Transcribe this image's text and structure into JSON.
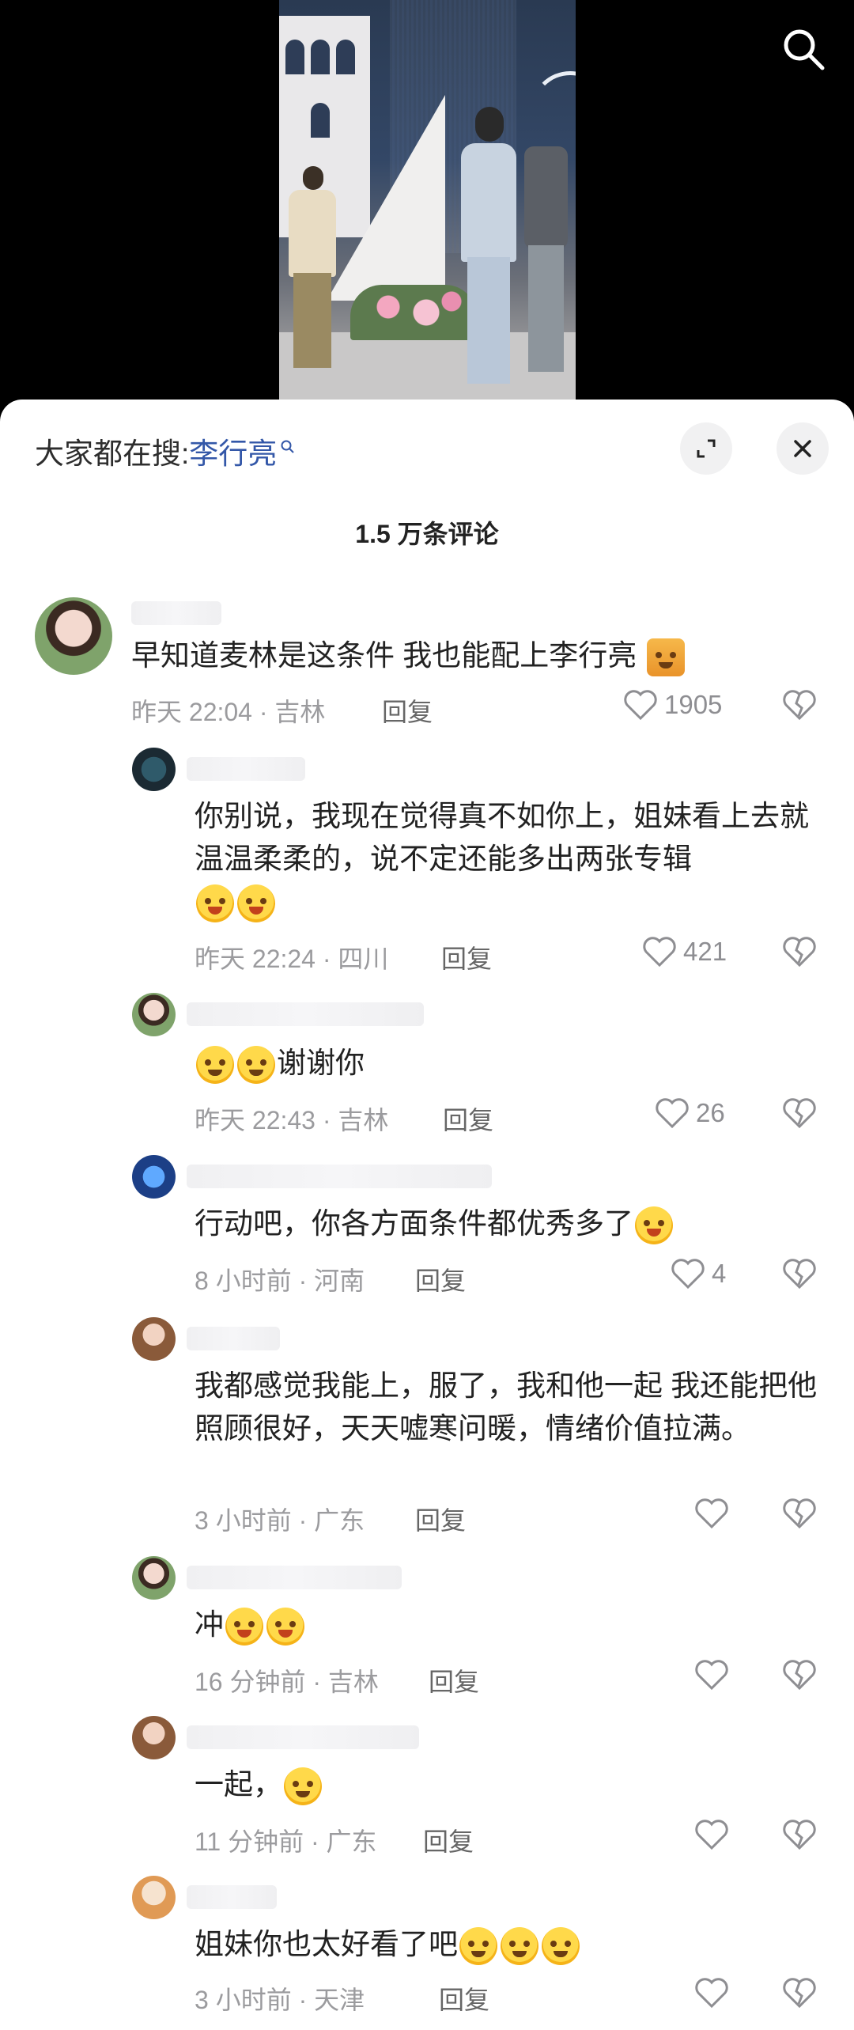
{
  "top": {
    "search_icon": "search-icon"
  },
  "sheet": {
    "search_prefix": "大家都在搜:",
    "search_term": "李行亮",
    "comment_count": "1.5 万条评论"
  },
  "comments": [
    {
      "text": "早知道麦林是这条件 我也能配上李行亮",
      "time": "昨天 22:04 · 吉林",
      "reply": "回复",
      "likes": "1905"
    },
    {
      "text": "你别说，我现在觉得真不如你上，姐妹看上去就温温柔柔的，说不定还能多出两张专辑",
      "time": "昨天 22:24 · 四川",
      "reply": "回复",
      "likes": "421"
    },
    {
      "text": "谢谢你",
      "time": "昨天 22:43 · 吉林",
      "reply": "回复",
      "likes": "26"
    },
    {
      "text": "行动吧，你各方面条件都优秀多了",
      "time": "8 小时前 · 河南",
      "reply": "回复",
      "likes": "4"
    },
    {
      "text": "我都感觉我能上，服了，我和他一起 我还能把他照顾很好，天天嘘寒问暖，情绪价值拉满。",
      "time": "3 小时前 · 广东",
      "reply": "回复",
      "likes": ""
    },
    {
      "text": "冲",
      "time": "16 分钟前 · 吉林",
      "reply": "回复",
      "likes": ""
    },
    {
      "text": "一起，",
      "time": "11 分钟前 · 广东",
      "reply": "回复",
      "likes": ""
    },
    {
      "text": "姐妹你也太好看了吧",
      "time": "3 小时前 · 天津",
      "reply": "回复",
      "likes": ""
    }
  ]
}
